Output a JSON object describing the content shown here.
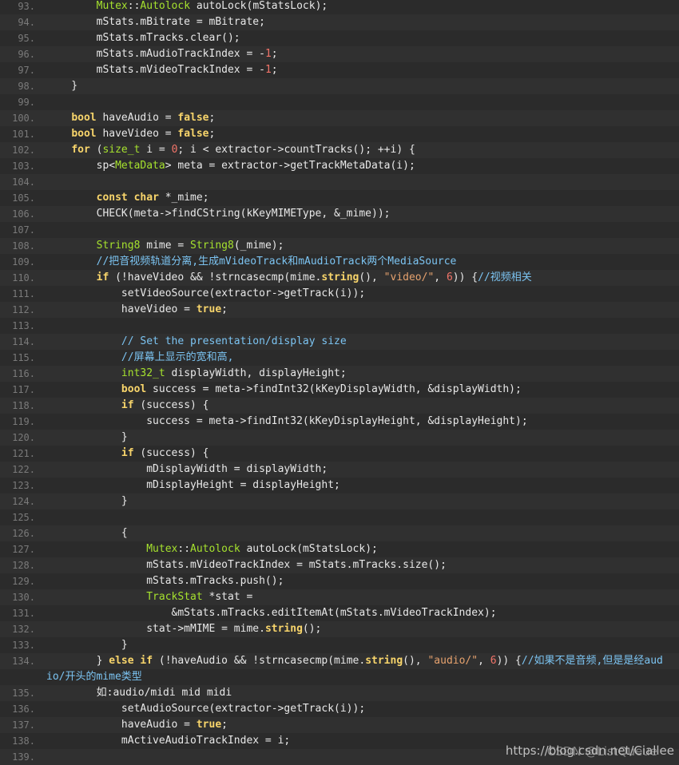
{
  "watermark": {
    "url": "https://blog.csdn.net/Ciallee",
    "overlay": "CSDN @ListQueue"
  },
  "lines": [
    {
      "n": "93.",
      "parts": [
        [
          "p",
          "        "
        ],
        [
          "ty",
          "Mutex"
        ],
        [
          "p",
          "::"
        ],
        [
          "ty",
          "Autolock"
        ],
        [
          "p",
          " autoLock(mStatsLock);"
        ]
      ]
    },
    {
      "n": "94.",
      "parts": [
        [
          "p",
          "        mStats.mBitrate = mBitrate;"
        ]
      ]
    },
    {
      "n": "95.",
      "parts": [
        [
          "p",
          "        mStats.mTracks.clear();"
        ]
      ]
    },
    {
      "n": "96.",
      "parts": [
        [
          "p",
          "        mStats.mAudioTrackIndex = -"
        ],
        [
          "num",
          "1"
        ],
        [
          "p",
          ";"
        ]
      ]
    },
    {
      "n": "97.",
      "parts": [
        [
          "p",
          "        mStats.mVideoTrackIndex = -"
        ],
        [
          "num",
          "1"
        ],
        [
          "p",
          ";"
        ]
      ]
    },
    {
      "n": "98.",
      "parts": [
        [
          "p",
          "    }"
        ]
      ]
    },
    {
      "n": "99.",
      "parts": [
        [
          "p",
          ""
        ]
      ]
    },
    {
      "n": "100.",
      "parts": [
        [
          "p",
          "    "
        ],
        [
          "kw",
          "bool"
        ],
        [
          "p",
          " haveAudio = "
        ],
        [
          "kw",
          "false"
        ],
        [
          "p",
          ";"
        ]
      ]
    },
    {
      "n": "101.",
      "parts": [
        [
          "p",
          "    "
        ],
        [
          "kw",
          "bool"
        ],
        [
          "p",
          " haveVideo = "
        ],
        [
          "kw",
          "false"
        ],
        [
          "p",
          ";"
        ]
      ]
    },
    {
      "n": "102.",
      "parts": [
        [
          "p",
          "    "
        ],
        [
          "kw",
          "for"
        ],
        [
          "p",
          " ("
        ],
        [
          "ty",
          "size_t"
        ],
        [
          "p",
          " i = "
        ],
        [
          "num",
          "0"
        ],
        [
          "p",
          "; i < extractor->countTracks(); ++i) {"
        ]
      ]
    },
    {
      "n": "103.",
      "parts": [
        [
          "p",
          "        sp<"
        ],
        [
          "ty",
          "MetaData"
        ],
        [
          "p",
          "> meta = extractor->getTrackMetaData(i);"
        ]
      ]
    },
    {
      "n": "104.",
      "parts": [
        [
          "p",
          ""
        ]
      ]
    },
    {
      "n": "105.",
      "parts": [
        [
          "p",
          "        "
        ],
        [
          "kw",
          "const"
        ],
        [
          "p",
          " "
        ],
        [
          "kw",
          "char"
        ],
        [
          "p",
          " *_mime;"
        ]
      ]
    },
    {
      "n": "106.",
      "parts": [
        [
          "p",
          "        CHECK(meta->findCString(kKeyMIMEType, &_mime));"
        ]
      ]
    },
    {
      "n": "107.",
      "parts": [
        [
          "p",
          ""
        ]
      ]
    },
    {
      "n": "108.",
      "parts": [
        [
          "p",
          "        "
        ],
        [
          "ty",
          "String8"
        ],
        [
          "p",
          " mime = "
        ],
        [
          "ty",
          "String8"
        ],
        [
          "p",
          "(_mime);"
        ]
      ]
    },
    {
      "n": "109.",
      "parts": [
        [
          "p",
          "        "
        ],
        [
          "cm",
          "//把音视频轨道分离,生成mVideoTrack和mAudioTrack两个MediaSource"
        ]
      ]
    },
    {
      "n": "110.",
      "parts": [
        [
          "p",
          "        "
        ],
        [
          "kw",
          "if"
        ],
        [
          "p",
          " (!haveVideo && !strncasecmp(mime."
        ],
        [
          "kw",
          "string"
        ],
        [
          "p",
          "(), "
        ],
        [
          "str",
          "\"video/\""
        ],
        [
          "p",
          ", "
        ],
        [
          "num",
          "6"
        ],
        [
          "p",
          ")) {"
        ],
        [
          "cm",
          "//视频相关"
        ]
      ]
    },
    {
      "n": "111.",
      "parts": [
        [
          "p",
          "            setVideoSource(extractor->getTrack(i));"
        ]
      ]
    },
    {
      "n": "112.",
      "parts": [
        [
          "p",
          "            haveVideo = "
        ],
        [
          "kw",
          "true"
        ],
        [
          "p",
          ";"
        ]
      ]
    },
    {
      "n": "113.",
      "parts": [
        [
          "p",
          ""
        ]
      ]
    },
    {
      "n": "114.",
      "parts": [
        [
          "p",
          "            "
        ],
        [
          "cm",
          "// Set the presentation/display size"
        ]
      ]
    },
    {
      "n": "115.",
      "parts": [
        [
          "p",
          "            "
        ],
        [
          "cm",
          "//屏幕上显示的宽和高,"
        ]
      ]
    },
    {
      "n": "116.",
      "parts": [
        [
          "p",
          "            "
        ],
        [
          "ty",
          "int32_t"
        ],
        [
          "p",
          " displayWidth, displayHeight;"
        ]
      ]
    },
    {
      "n": "117.",
      "parts": [
        [
          "p",
          "            "
        ],
        [
          "kw",
          "bool"
        ],
        [
          "p",
          " success = meta->findInt32(kKeyDisplayWidth, &displayWidth);"
        ]
      ]
    },
    {
      "n": "118.",
      "parts": [
        [
          "p",
          "            "
        ],
        [
          "kw",
          "if"
        ],
        [
          "p",
          " (success) {"
        ]
      ]
    },
    {
      "n": "119.",
      "parts": [
        [
          "p",
          "                success = meta->findInt32(kKeyDisplayHeight, &displayHeight);"
        ]
      ]
    },
    {
      "n": "120.",
      "parts": [
        [
          "p",
          "            }"
        ]
      ]
    },
    {
      "n": "121.",
      "parts": [
        [
          "p",
          "            "
        ],
        [
          "kw",
          "if"
        ],
        [
          "p",
          " (success) {"
        ]
      ]
    },
    {
      "n": "122.",
      "parts": [
        [
          "p",
          "                mDisplayWidth = displayWidth;"
        ]
      ]
    },
    {
      "n": "123.",
      "parts": [
        [
          "p",
          "                mDisplayHeight = displayHeight;"
        ]
      ]
    },
    {
      "n": "124.",
      "parts": [
        [
          "p",
          "            }"
        ]
      ]
    },
    {
      "n": "125.",
      "parts": [
        [
          "p",
          ""
        ]
      ]
    },
    {
      "n": "126.",
      "parts": [
        [
          "p",
          "            {"
        ]
      ]
    },
    {
      "n": "127.",
      "parts": [
        [
          "p",
          "                "
        ],
        [
          "ty",
          "Mutex"
        ],
        [
          "p",
          "::"
        ],
        [
          "ty",
          "Autolock"
        ],
        [
          "p",
          " autoLock(mStatsLock);"
        ]
      ]
    },
    {
      "n": "128.",
      "parts": [
        [
          "p",
          "                mStats.mVideoTrackIndex = mStats.mTracks.size();"
        ]
      ]
    },
    {
      "n": "129.",
      "parts": [
        [
          "p",
          "                mStats.mTracks.push();"
        ]
      ]
    },
    {
      "n": "130.",
      "parts": [
        [
          "p",
          "                "
        ],
        [
          "ty",
          "TrackStat"
        ],
        [
          "p",
          " *stat ="
        ]
      ]
    },
    {
      "n": "131.",
      "parts": [
        [
          "p",
          "                    &mStats.mTracks.editItemAt(mStats.mVideoTrackIndex);"
        ]
      ]
    },
    {
      "n": "132.",
      "parts": [
        [
          "p",
          "                stat->mMIME = mime."
        ],
        [
          "kw",
          "string"
        ],
        [
          "p",
          "();"
        ]
      ]
    },
    {
      "n": "133.",
      "parts": [
        [
          "p",
          "            }"
        ]
      ]
    },
    {
      "n": "134.",
      "parts": [
        [
          "p",
          "        } "
        ],
        [
          "kw",
          "else"
        ],
        [
          "p",
          " "
        ],
        [
          "kw",
          "if"
        ],
        [
          "p",
          " (!haveAudio && !strncasecmp(mime."
        ],
        [
          "kw",
          "string"
        ],
        [
          "p",
          "(), "
        ],
        [
          "str",
          "\"audio/\""
        ],
        [
          "p",
          ", "
        ],
        [
          "num",
          "6"
        ],
        [
          "p",
          ")) {"
        ],
        [
          "cm",
          "//如果不是音频,但是是经aud"
        ]
      ]
    },
    {
      "n": "",
      "parts": [
        [
          "p",
          ""
        ],
        [
          "cm",
          "io/开头的mime类型"
        ]
      ]
    },
    {
      "n": "135.",
      "parts": [
        [
          "p",
          "        如:audio/midi mid midi"
        ]
      ]
    },
    {
      "n": "136.",
      "parts": [
        [
          "p",
          "            setAudioSource(extractor->getTrack(i));"
        ]
      ]
    },
    {
      "n": "137.",
      "parts": [
        [
          "p",
          "            haveAudio = "
        ],
        [
          "kw",
          "true"
        ],
        [
          "p",
          ";"
        ]
      ]
    },
    {
      "n": "138.",
      "parts": [
        [
          "p",
          "            mActiveAudioTrackIndex = i;"
        ]
      ]
    },
    {
      "n": "139.",
      "parts": [
        [
          "p",
          ""
        ]
      ]
    }
  ]
}
